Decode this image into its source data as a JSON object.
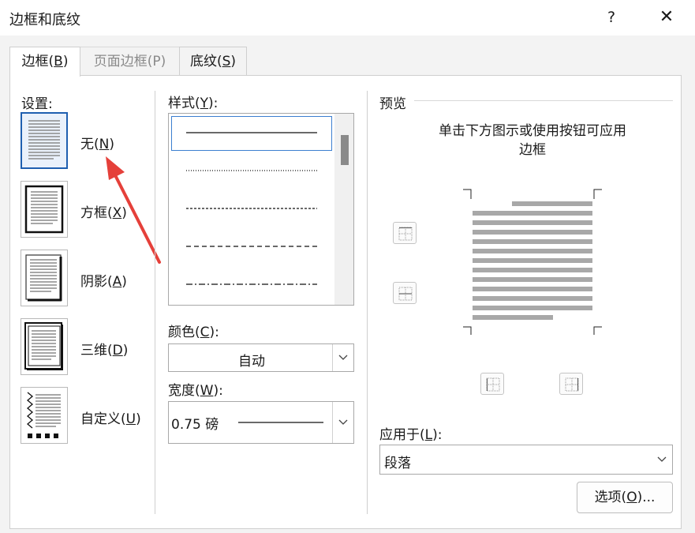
{
  "window": {
    "title": "边框和底纹",
    "help": "?",
    "close": "✕"
  },
  "tabs": [
    {
      "label": "边框(",
      "key": "B",
      "tail": ")"
    },
    {
      "label": "页面边框(P)"
    },
    {
      "label": "底纹(",
      "key": "S",
      "tail": ")"
    }
  ],
  "settings": {
    "heading": "设置:",
    "items": [
      {
        "label": "无(",
        "key": "N",
        "tail": ")"
      },
      {
        "label": "方框(",
        "key": "X",
        "tail": ")"
      },
      {
        "label": "阴影(",
        "key": "A",
        "tail": ")"
      },
      {
        "label": "三维(",
        "key": "D",
        "tail": ")"
      },
      {
        "label": "自定义(",
        "key": "U",
        "tail": ")"
      }
    ]
  },
  "style": {
    "heading_pre": "样式(",
    "key": "Y",
    "heading_post": "):"
  },
  "color": {
    "heading_pre": "颜色(",
    "key": "C",
    "heading_post": "):",
    "value": "自动"
  },
  "width": {
    "heading_pre": "宽度(",
    "key": "W",
    "heading_post": "):",
    "value": "0.75 磅"
  },
  "preview": {
    "heading": "预览",
    "instruction_line1": "单击下方图示或使用按钮可应用",
    "instruction_line2": "边框"
  },
  "apply_to": {
    "heading_pre": "应用于(",
    "key": "L",
    "heading_post": "):",
    "value": "段落"
  },
  "options_button": {
    "label_pre": "选项(",
    "key": "O",
    "label_post": ")..."
  }
}
